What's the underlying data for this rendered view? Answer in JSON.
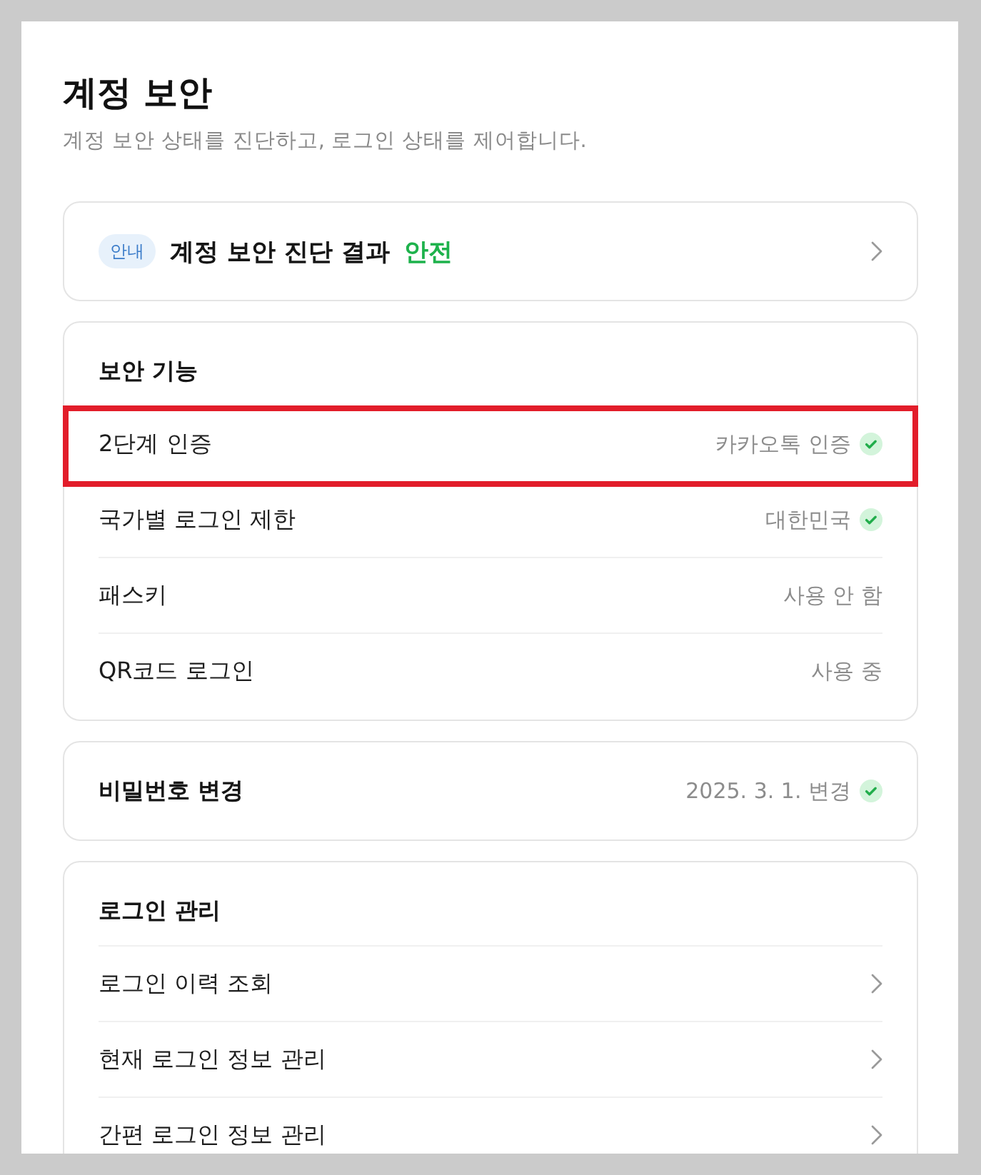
{
  "page": {
    "title": "계정 보안",
    "subtitle": "계정 보안 상태를 진단하고, 로그인 상태를 제어합니다."
  },
  "diagnosis": {
    "badge": "안내",
    "title": "계정 보안 진단 결과",
    "status": "안전"
  },
  "security_features": {
    "heading": "보안 기능",
    "rows": [
      {
        "label": "2단계 인증",
        "value": "카카오톡 인증",
        "verified": true,
        "highlighted": true
      },
      {
        "label": "국가별 로그인 제한",
        "value": "대한민국",
        "verified": true,
        "highlighted": false
      },
      {
        "label": "패스키",
        "value": "사용 안 함",
        "verified": false,
        "highlighted": false
      },
      {
        "label": "QR코드 로그인",
        "value": "사용 중",
        "verified": false,
        "highlighted": false
      }
    ]
  },
  "password": {
    "label": "비밀번호 변경",
    "value": "2025. 3. 1. 변경",
    "verified": true
  },
  "login_management": {
    "heading": "로그인 관리",
    "items": [
      {
        "label": "로그인 이력 조회"
      },
      {
        "label": "현재 로그인 정보 관리"
      },
      {
        "label": "간편 로그인 정보 관리"
      }
    ]
  }
}
